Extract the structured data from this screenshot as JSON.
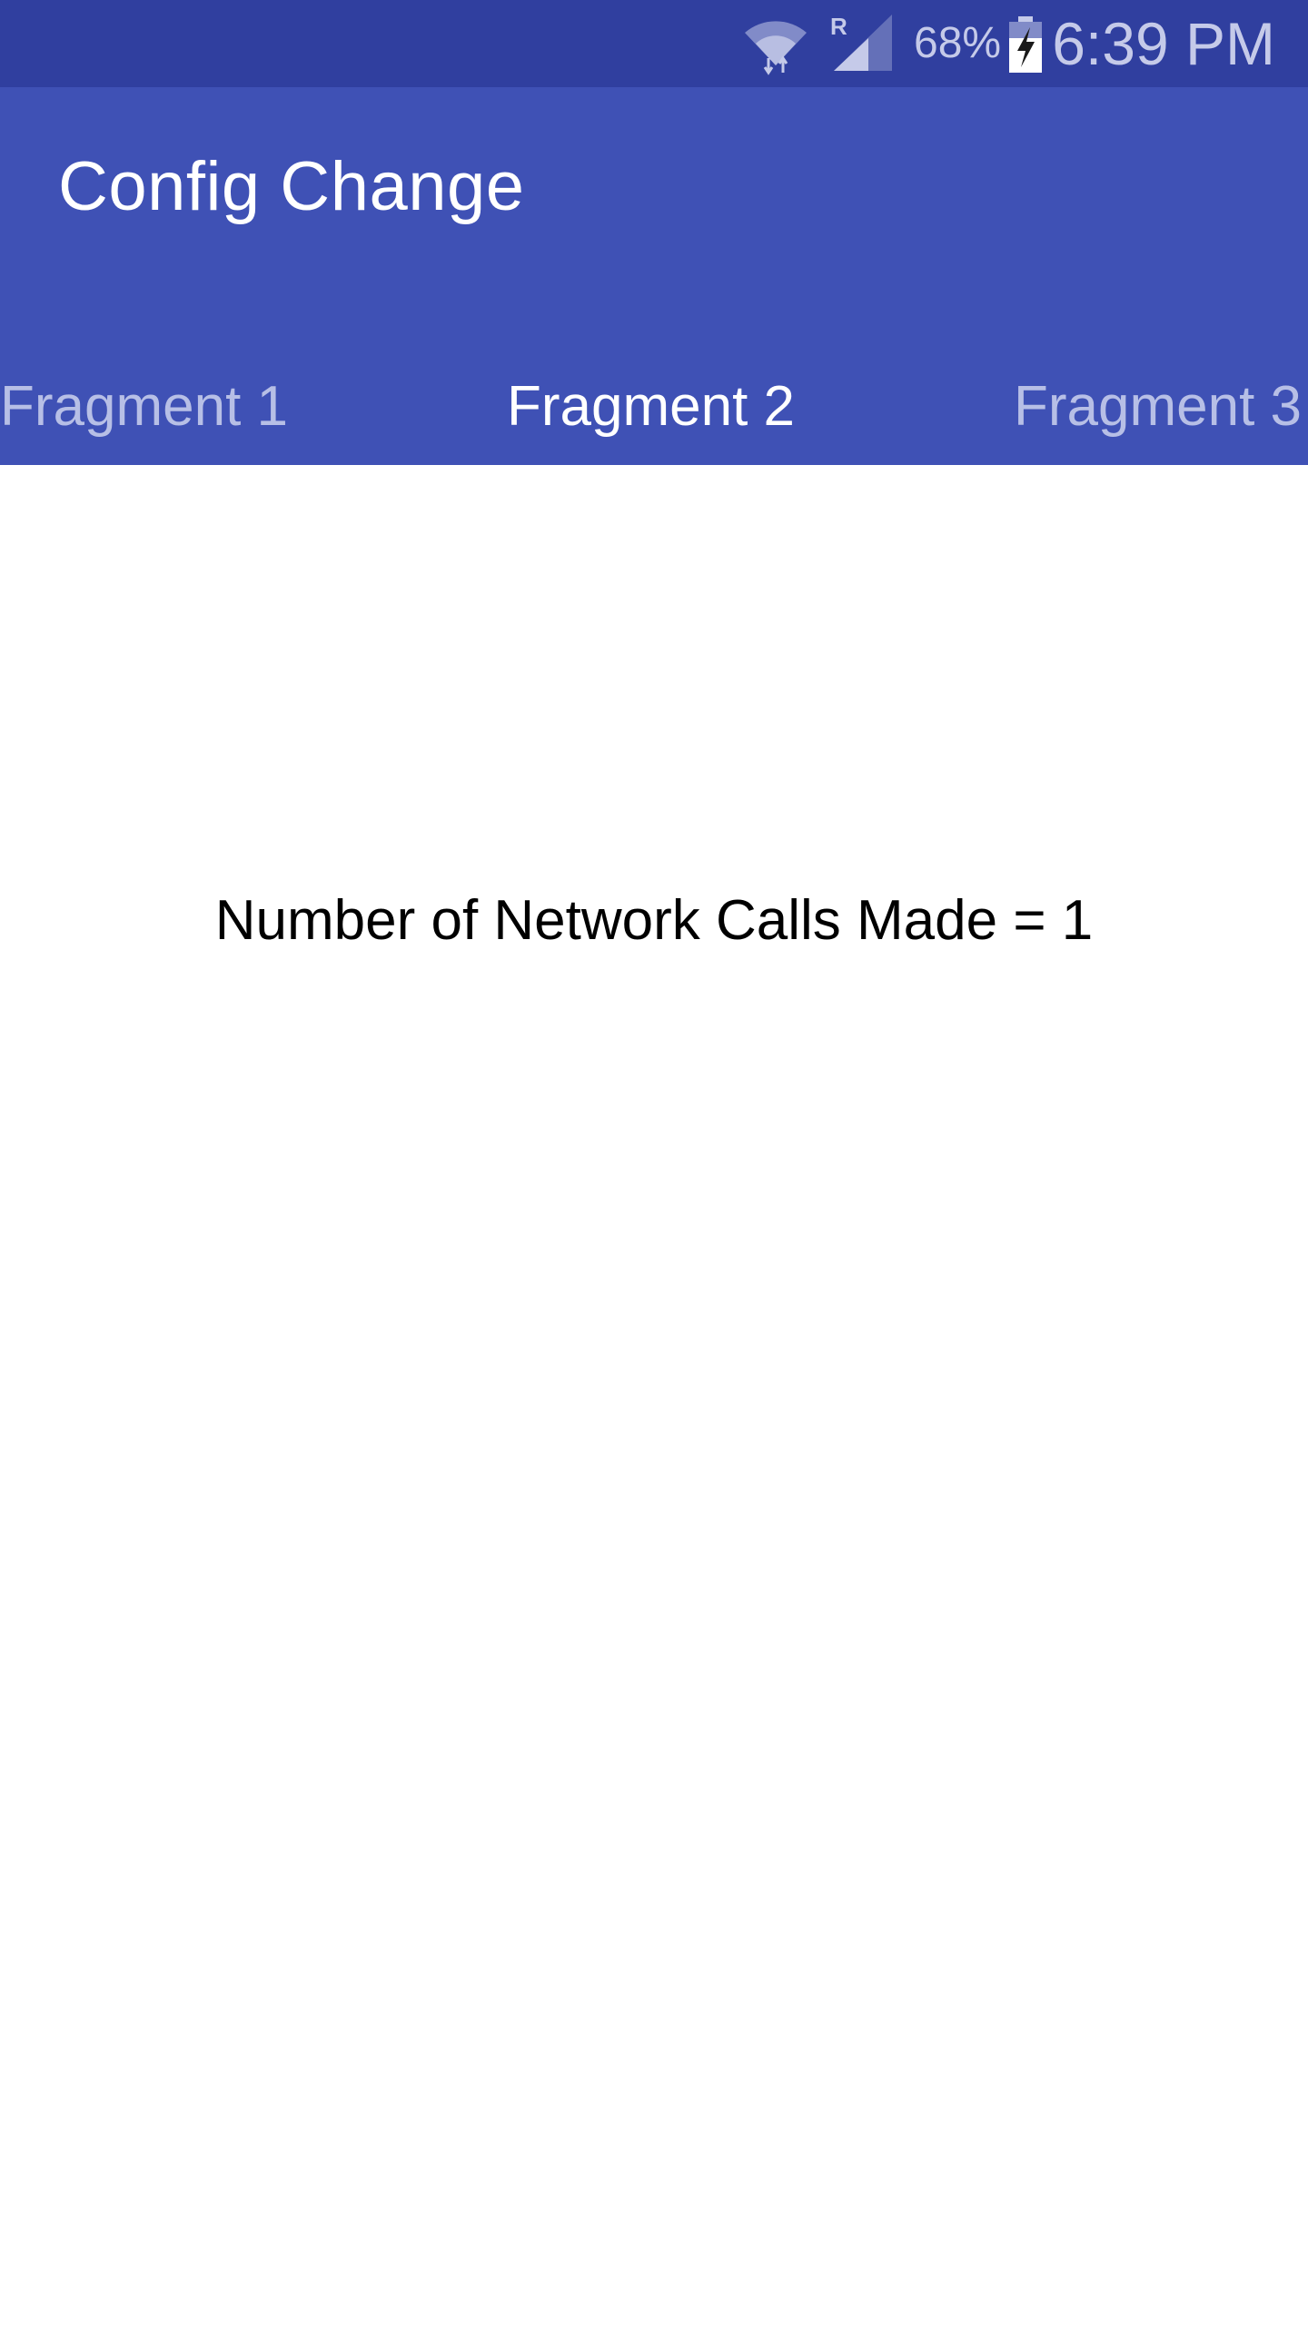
{
  "status_bar": {
    "wifi_icon": "wifi-icon",
    "signal_icon": "cellular-signal-roaming-icon",
    "battery_percent": "68%",
    "battery_icon": "battery-charging-icon",
    "time": "6:39 PM"
  },
  "app_bar": {
    "title": "Config Change",
    "tabs": [
      {
        "label": "Fragment 1",
        "selected": false
      },
      {
        "label": "Fragment 2",
        "selected": true
      },
      {
        "label": "Fragment 3",
        "selected": false
      }
    ]
  },
  "content": {
    "network_calls_text": "Number of Network Calls Made = 1"
  },
  "colors": {
    "status_bar": "#303f9f",
    "app_bar": "#3f51b5",
    "tab_inactive_text": "#b7bfe6",
    "tab_active_text": "#ffffff"
  }
}
